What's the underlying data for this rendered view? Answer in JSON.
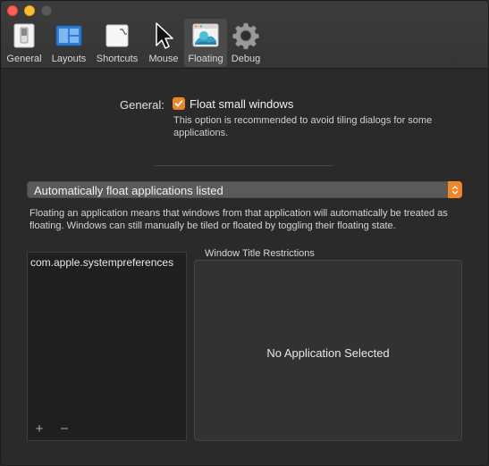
{
  "window": {
    "traffic_lights": [
      "close",
      "minimize",
      "zoom"
    ]
  },
  "toolbar": {
    "tabs": [
      {
        "label": "General",
        "icon": "switch-icon"
      },
      {
        "label": "Layouts",
        "icon": "layout-icon"
      },
      {
        "label": "Shortcuts",
        "icon": "keyboard-icon"
      },
      {
        "label": "Mouse",
        "icon": "cursor-icon"
      },
      {
        "label": "Floating",
        "icon": "floating-window-icon",
        "active": true
      },
      {
        "label": "Debug",
        "icon": "gear-icon"
      }
    ]
  },
  "general": {
    "label": "General:",
    "float_small_windows": {
      "checked": true,
      "label": "Float small windows",
      "help": "This option is recommended to avoid tiling dialogs for some applications."
    }
  },
  "float_mode": {
    "selected": "Automatically float applications listed",
    "description": "Floating an application means that windows from that application will automatically be treated as floating. Windows can still manually be tiled or floated by toggling their floating state."
  },
  "app_list": {
    "items": [
      "com.apple.systempreferences"
    ],
    "add_label": "+",
    "remove_label": "−"
  },
  "restrictions": {
    "title": "Window Title Restrictions",
    "empty_text": "No Application Selected"
  },
  "colors": {
    "accent": "#f0862a",
    "background": "#2a2a2a"
  }
}
